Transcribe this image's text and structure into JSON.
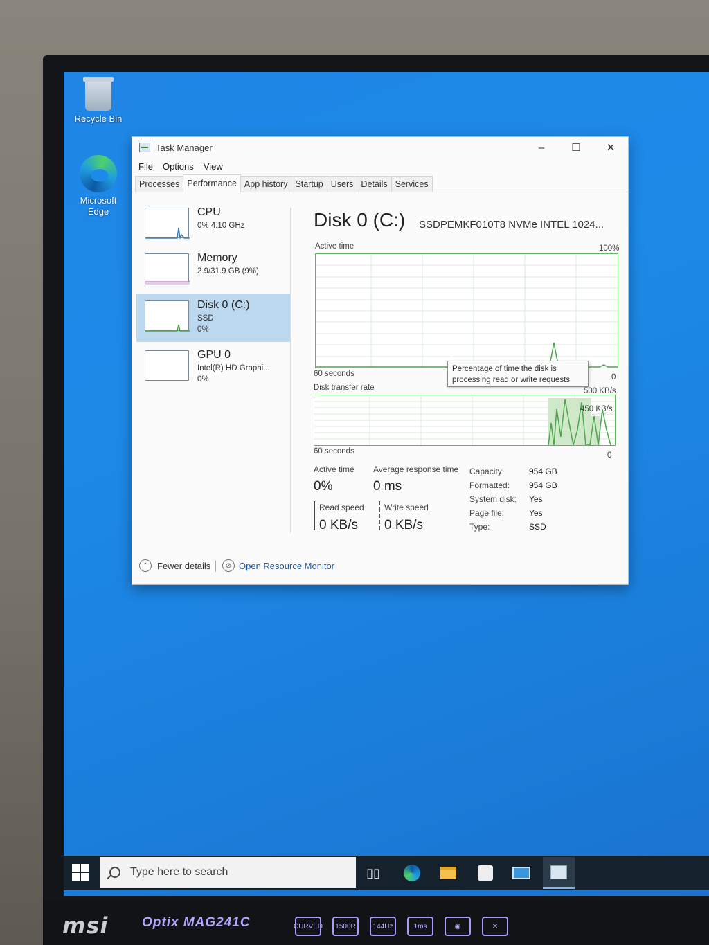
{
  "desktop": {
    "icons": [
      {
        "label": "Recycle Bin"
      },
      {
        "label": "Microsoft Edge"
      }
    ]
  },
  "window": {
    "title": "Task Manager",
    "controls": {
      "minimize": "–",
      "maximize": "☐",
      "close": "✕"
    },
    "menu": [
      "File",
      "Options",
      "View"
    ],
    "tabs": [
      "Processes",
      "Performance",
      "App history",
      "Startup",
      "Users",
      "Details",
      "Services"
    ],
    "active_tab": "Performance"
  },
  "sidebar": {
    "items": [
      {
        "title": "CPU",
        "sub1": "0% 4.10 GHz",
        "sub2": ""
      },
      {
        "title": "Memory",
        "sub1": "2.9/31.9 GB (9%)",
        "sub2": ""
      },
      {
        "title": "Disk 0 (C:)",
        "sub1": "SSD",
        "sub2": "0%"
      },
      {
        "title": "GPU 0",
        "sub1": "Intel(R) HD Graphi...",
        "sub2": "0%"
      }
    ],
    "selected_index": 2
  },
  "detail": {
    "title": "Disk 0 (C:)",
    "model": "SSDPEMKF010T8 NVMe INTEL 1024...",
    "active_time_graph": {
      "label": "Active time",
      "max_label": "100%",
      "min_label": "0",
      "time_label": "60 seconds"
    },
    "transfer_graph": {
      "label": "Disk transfer rate",
      "max_label": "500 KB/s",
      "mid_label": "450 KB/s",
      "min_label": "0",
      "time_label": "60 seconds"
    },
    "tooltip": {
      "line1": "Percentage of time the disk is",
      "line2": "processing read or write requests"
    },
    "stats": {
      "active_time": {
        "label": "Active time",
        "value": "0%"
      },
      "avg_response": {
        "label": "Average response time",
        "value": "0 ms"
      },
      "read_speed": {
        "label": "Read speed",
        "value": "0 KB/s"
      },
      "write_speed": {
        "label": "Write speed",
        "value": "0 KB/s"
      }
    },
    "properties": [
      {
        "key": "Capacity:",
        "value": "954 GB"
      },
      {
        "key": "Formatted:",
        "value": "954 GB"
      },
      {
        "key": "System disk:",
        "value": "Yes"
      },
      {
        "key": "Page file:",
        "value": "Yes"
      },
      {
        "key": "Type:",
        "value": "SSD"
      }
    ]
  },
  "footer": {
    "fewer_details": "Fewer details",
    "resource_monitor": "Open Resource Monitor"
  },
  "taskbar": {
    "search_placeholder": "Type here to search"
  },
  "monitor": {
    "brand": "msi",
    "model": "Optix MAG241C",
    "badges": [
      "CURVED",
      "1500R",
      "144Hz",
      "1ms",
      "",
      ""
    ]
  },
  "colors": {
    "desktop_blue": "#1d8ae8",
    "graph_green": "#5bb85b",
    "selected_row": "#bcd8ee",
    "link_blue": "#1a5aa8"
  }
}
